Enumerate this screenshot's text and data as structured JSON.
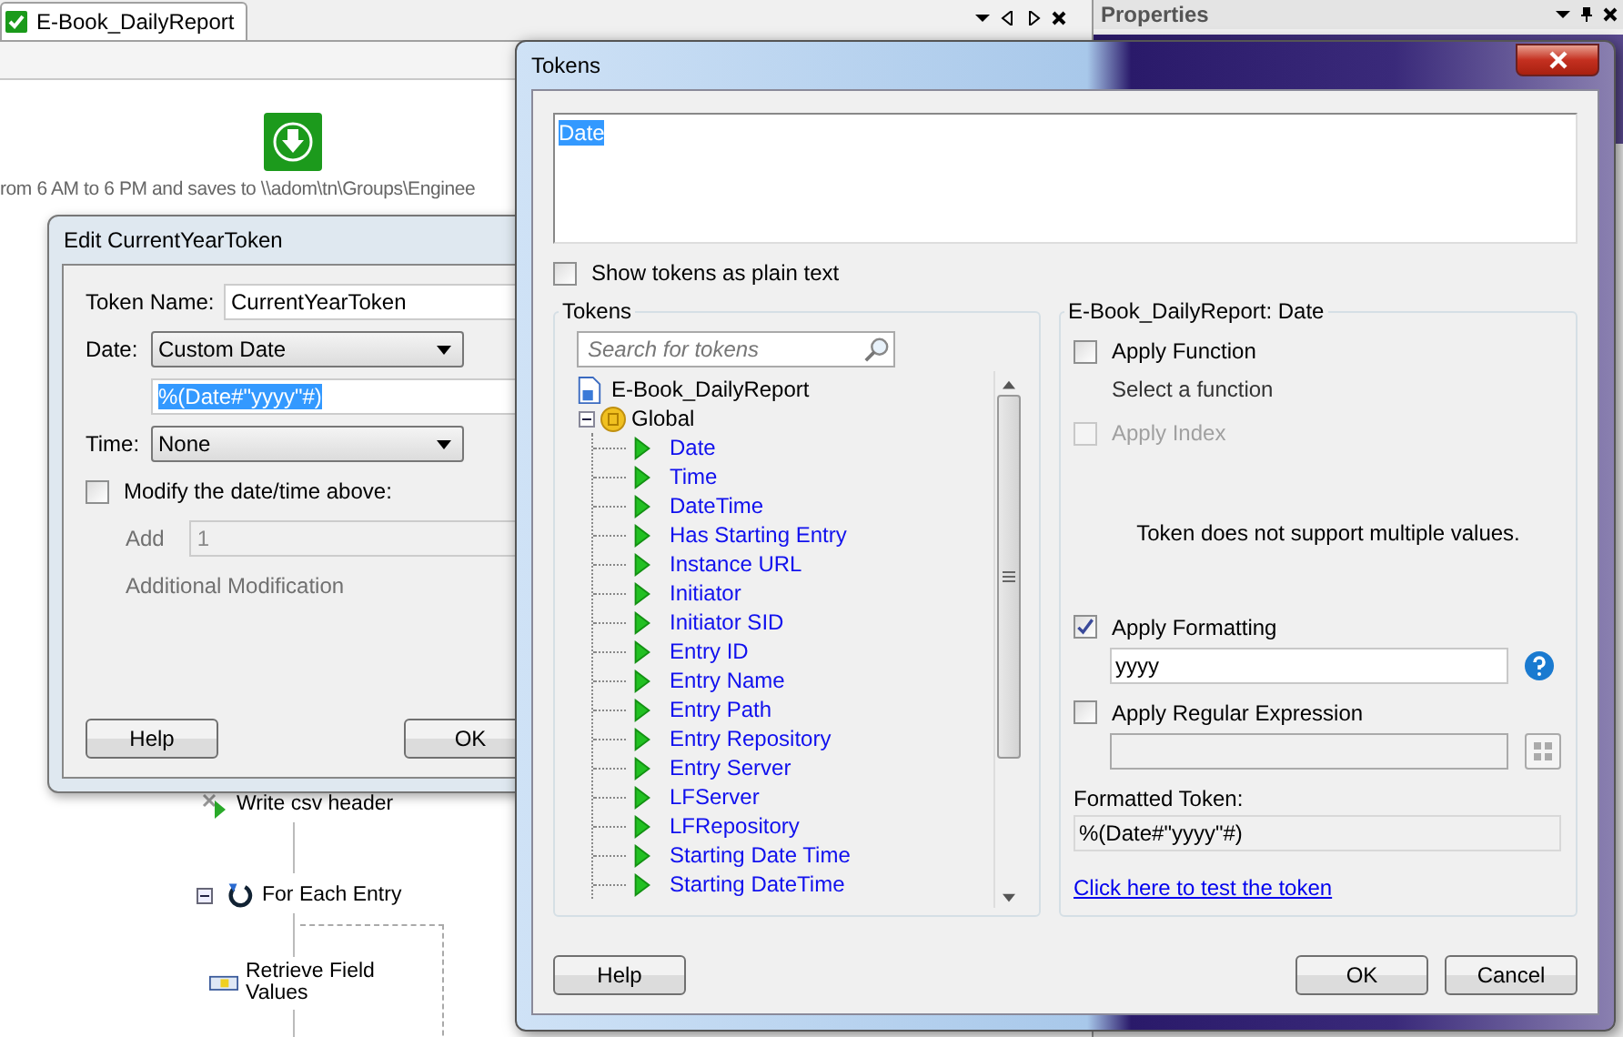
{
  "editor_tab": {
    "label": "E-Book_DailyReport"
  },
  "properties_panel": {
    "title": "Properties"
  },
  "workflow": {
    "description": "rom 6 AM to 6 PM and saves to \\\\adom\\tn\\Groups\\Enginee",
    "steps": [
      {
        "kind": "action",
        "label": "Write csv header"
      },
      {
        "kind": "loop",
        "label": "For Each Entry"
      },
      {
        "kind": "field",
        "label": "Retrieve Field Values"
      }
    ]
  },
  "edit_dialog": {
    "title": "Edit CurrentYearToken",
    "token_name_label": "Token Name:",
    "token_name": "CurrentYearToken",
    "date_label": "Date:",
    "date_value": "Custom Date",
    "date_format": "%(Date#\"yyyy\"#)",
    "time_label": "Time:",
    "time_value": "None",
    "modify": {
      "label": "Modify the date/time above:",
      "checked": false
    },
    "add_label": "Add",
    "add_value": "1",
    "additional_label": "Additional Modification",
    "buttons": [
      "Help",
      "OK"
    ]
  },
  "tokens_dialog": {
    "title": "Tokens",
    "expression": "Date",
    "plain_text": {
      "label": "Show tokens as plain text",
      "checked": false
    },
    "tree_group": "Tokens",
    "search": {
      "placeholder": "Search for tokens"
    },
    "tree": {
      "label": "E-Book_DailyReport",
      "children": [
        {
          "label": "Global",
          "children": [
            {
              "label": "Date"
            },
            {
              "label": "Time"
            },
            {
              "label": "DateTime"
            },
            {
              "label": "Has Starting Entry"
            },
            {
              "label": "Instance URL"
            },
            {
              "label": "Initiator"
            },
            {
              "label": "Initiator SID"
            },
            {
              "label": "Entry ID"
            },
            {
              "label": "Entry Name"
            },
            {
              "label": "Entry Path"
            },
            {
              "label": "Entry Repository"
            },
            {
              "label": "Entry Server"
            },
            {
              "label": "LFServer"
            },
            {
              "label": "LFRepository"
            },
            {
              "label": "Starting Date Time"
            },
            {
              "label": "Starting DateTime"
            }
          ]
        }
      ]
    },
    "details": {
      "title": "E-Book_DailyReport: Date",
      "apply_function": {
        "label": "Apply Function",
        "checked": false,
        "disabled": false
      },
      "function_hint": "Select a function",
      "apply_index": {
        "label": "Apply Index",
        "checked": false,
        "disabled": true
      },
      "note": "Token does not support multiple values.",
      "apply_formatting": {
        "label": "Apply Formatting",
        "checked": true,
        "disabled": false
      },
      "format_value": "yyyy",
      "apply_regex": {
        "label": "Apply Regular Expression",
        "checked": false,
        "disabled": false
      },
      "formatted_label": "Formatted Token:",
      "formatted_value": "%(Date#\"yyyy\"#)",
      "test_link": "Click here to test the token"
    },
    "buttons": {
      "help": "Help",
      "ok": "OK",
      "cancel": "Cancel"
    }
  }
}
